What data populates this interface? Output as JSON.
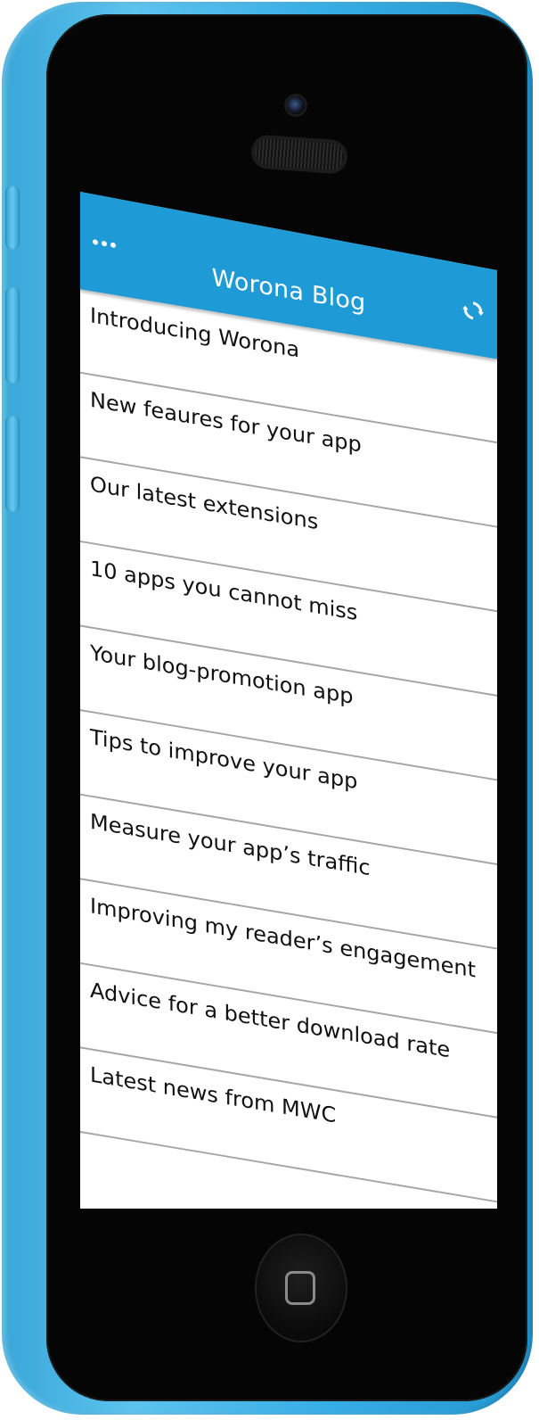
{
  "app": {
    "title": "Worona Blog",
    "menu_icon": "more-dots-icon",
    "refresh_icon": "refresh-icon"
  },
  "posts": [
    {
      "title": "Introducing Worona"
    },
    {
      "title": "New feaures for your app"
    },
    {
      "title": "Our latest extensions"
    },
    {
      "title": "10 apps you cannot miss"
    },
    {
      "title": "Your blog-promotion app"
    },
    {
      "title": "Tips to improve your app"
    },
    {
      "title": "Measure your app’s traffic"
    },
    {
      "title": "Improving my reader’s engagement"
    },
    {
      "title": "Advice for a better download rate"
    },
    {
      "title": "Latest news from MWC"
    }
  ],
  "colors": {
    "appbar": "#1e9ad6",
    "phone_shell": "#38aee6",
    "list_text": "#111111",
    "divider": "#a5a5a5"
  }
}
